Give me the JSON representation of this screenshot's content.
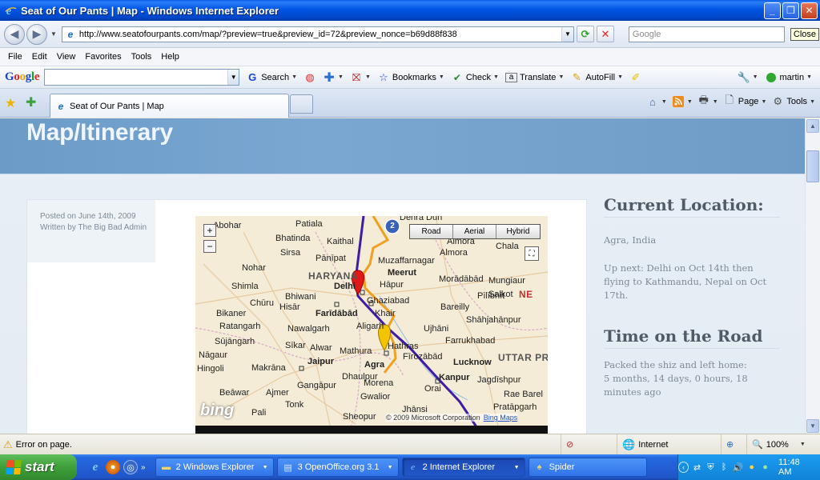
{
  "window": {
    "title": "Seat of Our Pants |  Map - Windows Internet Explorer"
  },
  "address": {
    "url": "http://www.seatofourpants.com/map/?preview=true&preview_id=72&preview_nonce=b69d88f838",
    "search_placeholder": "Google",
    "close_tooltip": "Close"
  },
  "menu": [
    "File",
    "Edit",
    "View",
    "Favorites",
    "Tools",
    "Help"
  ],
  "google_toolbar": {
    "logo": [
      "G",
      "o",
      "o",
      "g",
      "l",
      "e"
    ],
    "search_label": "Search",
    "bookmarks_label": "Bookmarks",
    "check_label": "Check",
    "translate_label": "Translate",
    "autofill_label": "AutoFill",
    "user_label": "martin"
  },
  "tabs": {
    "active_label": "Seat of Our Pants |  Map"
  },
  "command_bar": {
    "page_label": "Page",
    "tools_label": "Tools"
  },
  "page": {
    "heading": "Map/Itinerary",
    "posted_on": "Posted on June 14th, 2009",
    "written_by": "Written by The Big Bad Admin",
    "current_location_heading": "Current Location:",
    "current_location": "Agra, India",
    "up_next": "Up next: Delhi on Oct 14th then flying to Kathmandu, Nepal on Oct 17th.",
    "time_heading": "Time on the Road",
    "time_line1": "Packed the shiz and left home:",
    "time_line2": "5 months, 14 days, 0 hours, 18 minutes ago"
  },
  "map": {
    "modes": [
      "Road",
      "Aerial",
      "Hybrid"
    ],
    "zoom_in": "+",
    "zoom_out": "−",
    "marker_number": "2",
    "logo": "bing",
    "copyright": "© 2009 Microsoft Corporation",
    "bing_maps_link": "Bing Maps",
    "places": [
      {
        "name": "Abohar"
      },
      {
        "name": "Patiala"
      },
      {
        "name": "Dehra Dun"
      },
      {
        "name": "Bhatinda"
      },
      {
        "name": "Kaithal"
      },
      {
        "name": "Almora"
      },
      {
        "name": "Sirsa"
      },
      {
        "name": "Pānīpat"
      },
      {
        "name": "Muzaffarnagar"
      },
      {
        "name": "Nohar"
      },
      {
        "name": "HARYANA"
      },
      {
        "name": "Meerut"
      },
      {
        "name": "Delhi"
      },
      {
        "name": "Hāpur"
      },
      {
        "name": "Morādābād"
      },
      {
        "name": "Shimla"
      },
      {
        "name": "Bhiwani"
      },
      {
        "name": "Ghaziabad"
      },
      {
        "name": "Chūru"
      },
      {
        "name": "Hisār"
      },
      {
        "name": "Bareilly"
      },
      {
        "name": "Bikaner"
      },
      {
        "name": "Farīdābād"
      },
      {
        "name": "Pīlībhīt"
      },
      {
        "name": "Ratangarh"
      },
      {
        "name": "Nawalgarh"
      },
      {
        "name": "Aligarh"
      },
      {
        "name": "Shāhjahānpur"
      },
      {
        "name": "Sūjāngarh"
      },
      {
        "name": "Ujhāni"
      },
      {
        "name": "Sīkar"
      },
      {
        "name": "Alwar"
      },
      {
        "name": "Farrukhabad"
      },
      {
        "name": "Nāgaur"
      },
      {
        "name": "Mathura"
      },
      {
        "name": "Hathras"
      },
      {
        "name": "Fīrozābād"
      },
      {
        "name": "UTTAR PRA"
      },
      {
        "name": "Jaipur"
      },
      {
        "name": "Agra"
      },
      {
        "name": "Lucknow"
      },
      {
        "name": "Hingoli"
      },
      {
        "name": "Makrāna"
      },
      {
        "name": "Dhaulpur"
      },
      {
        "name": "Kanpur"
      },
      {
        "name": "Gangāpur"
      },
      {
        "name": "Morena"
      },
      {
        "name": "Jagdīshpur"
      },
      {
        "name": "Beāwar"
      },
      {
        "name": "Ajmer"
      },
      {
        "name": "Gwalior"
      },
      {
        "name": "Orai"
      },
      {
        "name": "Rae Barel"
      },
      {
        "name": "Tonk"
      },
      {
        "name": "Sheopur"
      },
      {
        "name": "Jhānsi"
      },
      {
        "name": "Pratāpgarh"
      },
      {
        "name": "Pali"
      },
      {
        "name": "Almora"
      },
      {
        "name": "Chala"
      },
      {
        "name": "Mungiaur"
      },
      {
        "name": "Salkot"
      },
      {
        "name": "NE"
      },
      {
        "name": "Khair"
      }
    ],
    "colors": {
      "route_purple": "#3f1ca3",
      "route_orange": "#f0a020",
      "marker_red": "#e01818",
      "marker_yellow": "#f5c400",
      "marker_blue": "#3a62b8"
    }
  },
  "status": {
    "message": "Error on page.",
    "zone": "Internet",
    "zoom": "100%"
  },
  "taskbar": {
    "start_label": "start",
    "items": [
      {
        "label": "2 Windows Explorer",
        "icon": "folder-icon"
      },
      {
        "label": "3 OpenOffice.org 3.1",
        "icon": "openoffice-icon"
      },
      {
        "label": "2 Internet Explorer",
        "icon": "ie-icon"
      },
      {
        "label": "Spider",
        "icon": "spider-icon"
      }
    ],
    "clock": "11:48 AM"
  }
}
